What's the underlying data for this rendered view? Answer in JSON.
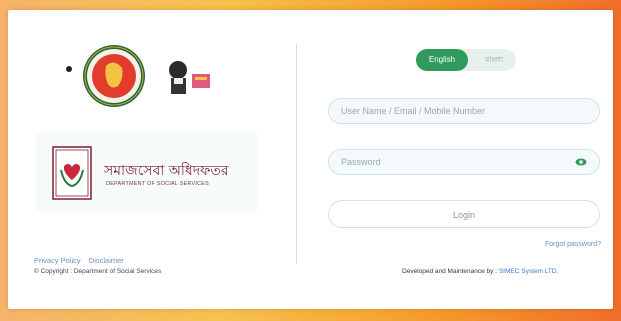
{
  "brand": {
    "department_bn": "সমাজসেবা অধিদফতর",
    "department_en": "DEPARTMENT OF SOCIAL SERVICES"
  },
  "language": {
    "english": "English",
    "bangla": "বাংলা",
    "selected": "English"
  },
  "form": {
    "username_placeholder": "User Name / Email / Mobile Number",
    "password_placeholder": "Password",
    "login_label": "Login",
    "forgot_label": "Forgot password?"
  },
  "footer": {
    "privacy": "Privacy Policy",
    "disclaimer": "Disclaimer",
    "copyright": "© Copyright : Department of Social Services",
    "developed_prefix": "Developed and Maintenance by : ",
    "developer": "SIMEC System LTD."
  },
  "colors": {
    "accent_green": "#2f9a5c",
    "link_blue": "#6a8fc4",
    "dss_maroon": "#7a1f2f"
  }
}
